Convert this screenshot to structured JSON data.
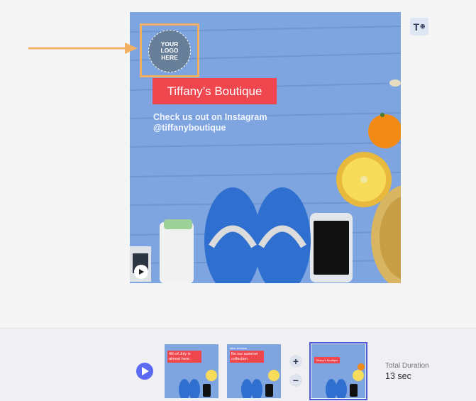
{
  "slide": {
    "logo_text": "YOUR\nLOGO\nHERE",
    "title": "Tiffany’s Boutique",
    "subtitle_line1": "Check us out on Instagram",
    "subtitle_line2": "@tiffanyboutique"
  },
  "toolbar": {
    "text_tool_label": "T"
  },
  "timeline": {
    "thumbnails": [
      {
        "label": "4th of July is almost here.",
        "top_text": ""
      },
      {
        "label": "Be our summer collection",
        "top_text": "New Arrivals"
      },
      {
        "label": "Tiffany’s Boutique",
        "top_text": ""
      }
    ],
    "total_duration_label": "Total Duration",
    "total_duration_value": "13 sec"
  },
  "colors": {
    "accent": "#5b6af0",
    "highlight_frame": "#f2b162",
    "title_bg": "#f0474f",
    "slide_bg": "#7fa6e0"
  },
  "icons": [
    "arrow-right-icon",
    "play-icon",
    "text-tool-icon",
    "plus-icon",
    "minus-icon"
  ]
}
